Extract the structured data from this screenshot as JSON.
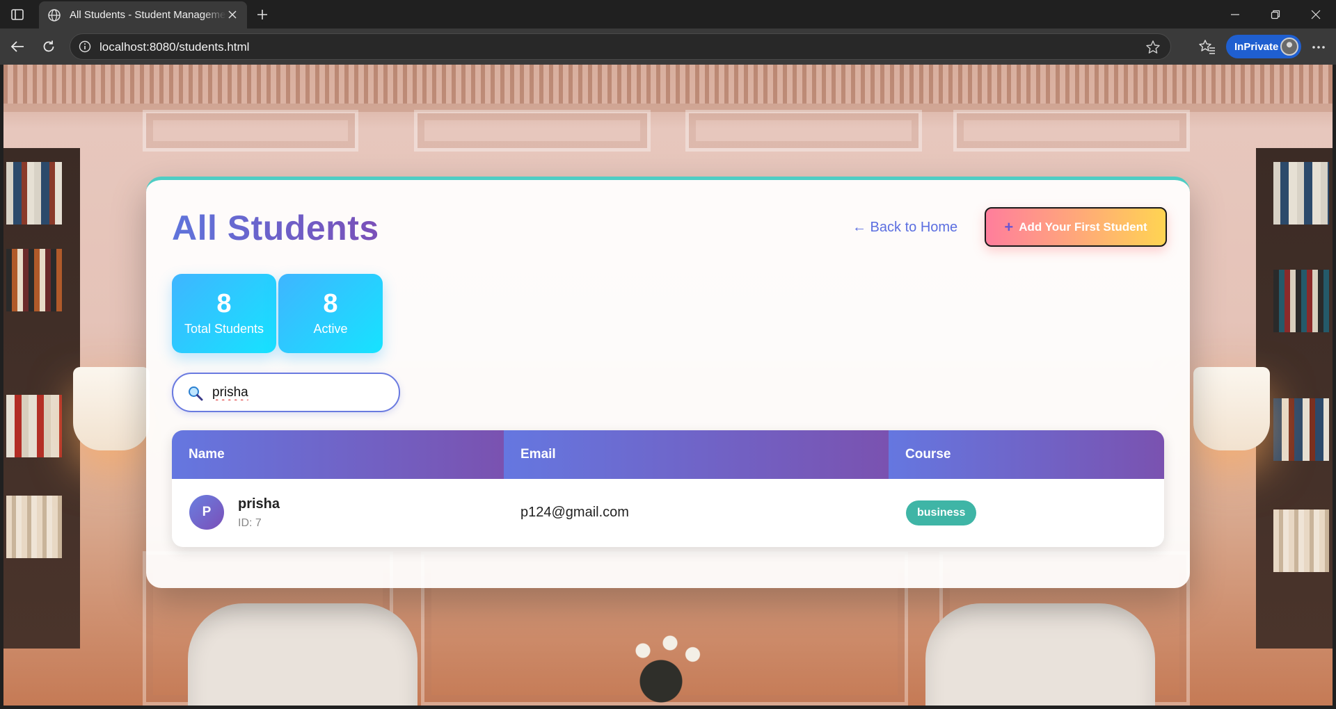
{
  "browser": {
    "tab_title": "All Students - Student Management System",
    "url": "localhost:8080/students.html",
    "inprivate_label": "InPrivate",
    "icons": [
      "sidebar-toggle-icon",
      "globe-icon",
      "close-icon",
      "plus-icon",
      "minimize-icon",
      "restore-icon",
      "back-arrow-icon",
      "refresh-icon",
      "info-icon",
      "star-icon",
      "favorites-icon",
      "more-icon"
    ]
  },
  "page": {
    "title": "All Students",
    "back_link": "← Back to Home",
    "add_button": "Add Your First Student",
    "add_button_icon": "+",
    "accent_top_border": "#4ecdc4"
  },
  "stats": [
    {
      "value": "8",
      "label": "Total Students"
    },
    {
      "value": "8",
      "label": "Active"
    }
  ],
  "search": {
    "value": "prisha",
    "icon": "search-icon"
  },
  "table": {
    "headers": [
      "Name",
      "Email",
      "Course"
    ],
    "rows": [
      {
        "initial": "P",
        "name": "prisha",
        "id_text": "ID: 7",
        "email": "p124@gmail.com",
        "course": "business"
      }
    ]
  }
}
